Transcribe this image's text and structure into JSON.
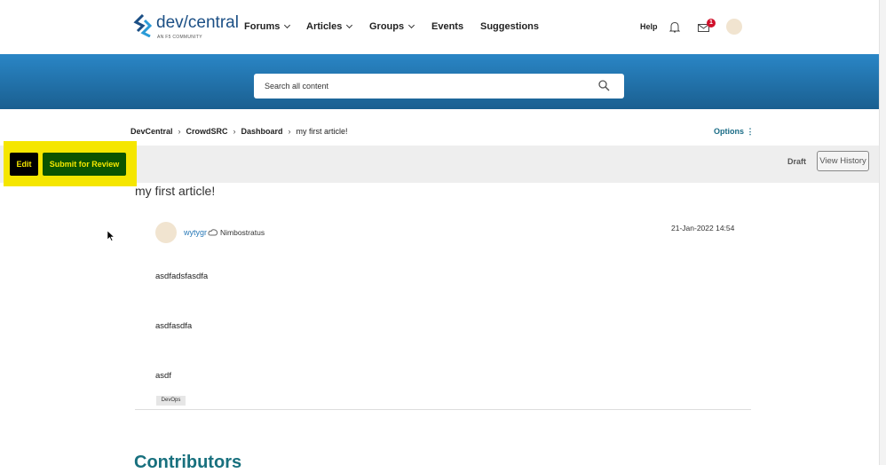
{
  "header": {
    "logo_text": "dev/central",
    "logo_sub": "AN F5 COMMUNITY",
    "nav": [
      "Forums",
      "Articles",
      "Groups",
      "Events",
      "Suggestions"
    ],
    "help": "Help",
    "mail_badge": "1"
  },
  "search": {
    "placeholder": "Search all content"
  },
  "breadcrumb": [
    "DevCentral",
    "CrowdSRC",
    "Dashboard",
    "my first article!"
  ],
  "options_label": "Options",
  "actions": {
    "edit": "Edit",
    "submit": "Submit for Review",
    "status": "Draft",
    "view_history": "View History"
  },
  "article": {
    "title": "my first article!",
    "author": "wytygr",
    "rank": "Nimbostratus",
    "date": "21-Jan-2022 14:54",
    "paragraphs": [
      "asdfadsfasdfa",
      "asdfasdfa",
      "asdf"
    ],
    "tag": "DevOps"
  },
  "contributors_heading": "Contributors",
  "colors": {
    "highlight": "#f5e600",
    "submit_bg": "#0b5400",
    "banner": "#1f70a8"
  }
}
